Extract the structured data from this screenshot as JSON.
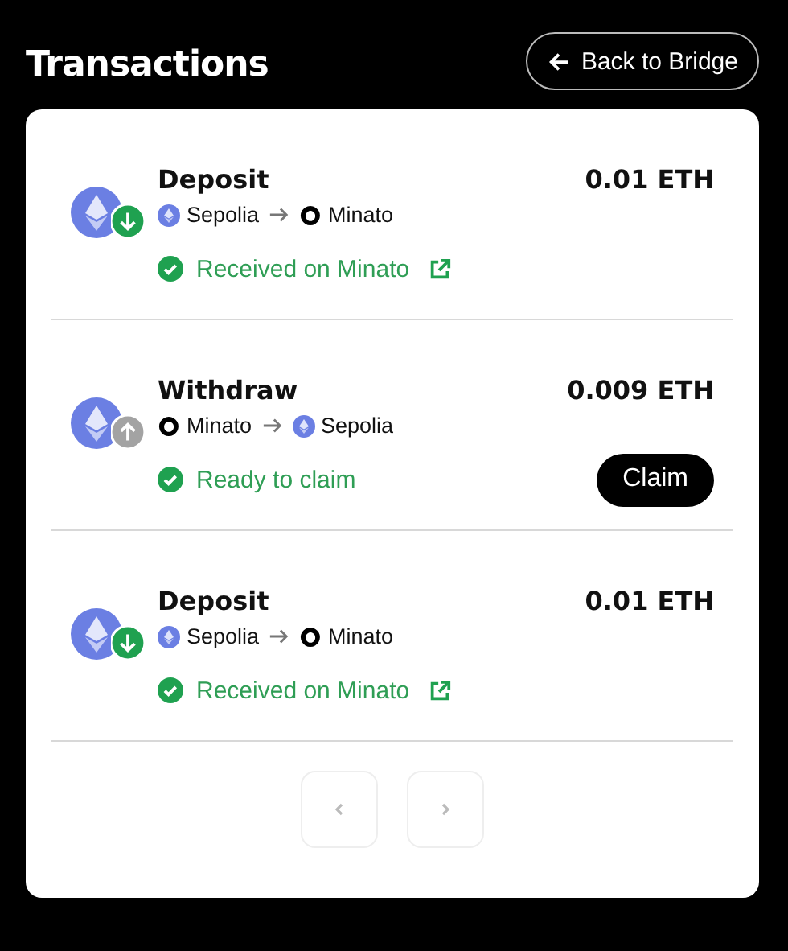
{
  "title": "Transactions",
  "back_button": {
    "label": "Back to Bridge"
  },
  "transactions": [
    {
      "type": "Deposit",
      "kind": "deposit",
      "amount": "0.01 ETH",
      "from": {
        "name": "Sepolia",
        "kind": "sepolia"
      },
      "to": {
        "name": "Minato",
        "kind": "minato"
      },
      "status": "Received on Minato",
      "link": true
    },
    {
      "type": "Withdraw",
      "kind": "withdraw",
      "amount": "0.009 ETH",
      "from": {
        "name": "Minato",
        "kind": "minato"
      },
      "to": {
        "name": "Sepolia",
        "kind": "sepolia"
      },
      "status": "Ready to claim",
      "link": false,
      "claim": "Claim"
    },
    {
      "type": "Deposit",
      "kind": "deposit",
      "amount": "0.01 ETH",
      "from": {
        "name": "Sepolia",
        "kind": "sepolia"
      },
      "to": {
        "name": "Minato",
        "kind": "minato"
      },
      "status": "Received on Minato",
      "link": true
    }
  ],
  "pagination": {
    "prev_disabled": true,
    "next_disabled": true
  }
}
